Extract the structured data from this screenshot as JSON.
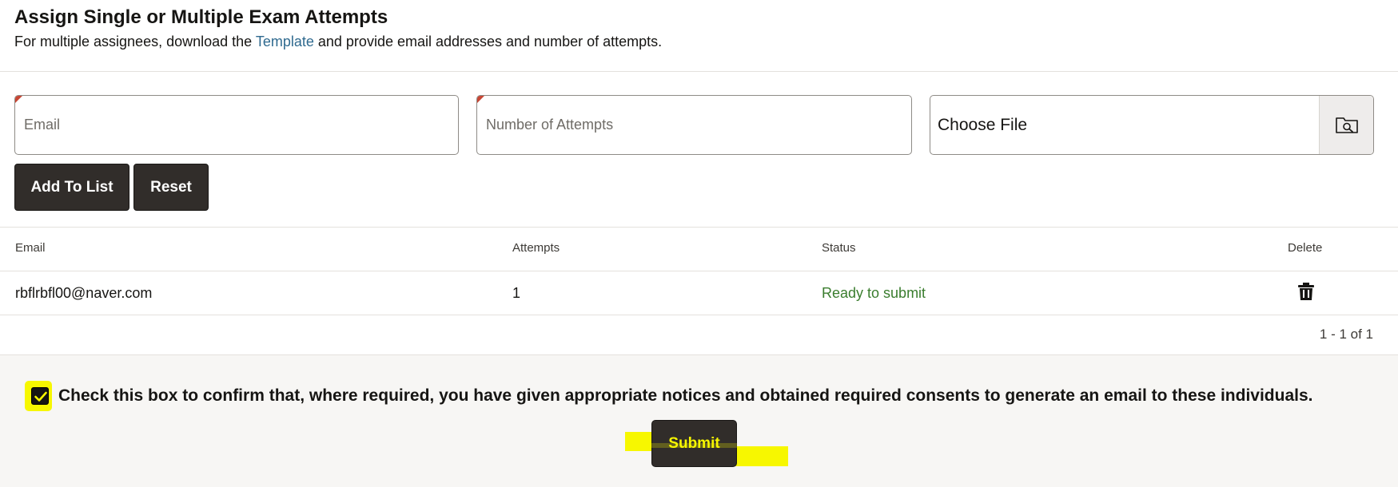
{
  "header": {
    "title": "Assign Single or Multiple Exam Attempts",
    "subtitle_before": "For multiple assignees, download the ",
    "subtitle_link": "Template",
    "subtitle_after": " and provide email addresses and number of attempts."
  },
  "form": {
    "email_placeholder": "Email",
    "attempts_placeholder": "Number of Attempts",
    "file_placeholder": "Choose File",
    "browse_icon": "folder-search-icon",
    "add_label": "Add To List",
    "reset_label": "Reset"
  },
  "table": {
    "columns": [
      "Email",
      "Attempts",
      "Status",
      "Delete"
    ],
    "rows": [
      {
        "email": "rbflrbfl00@naver.com",
        "attempts": "1",
        "status": "Ready to submit",
        "delete_icon": "trash-icon"
      }
    ],
    "pagination": "1 - 1 of 1"
  },
  "footer": {
    "consent_checked": true,
    "consent_text": "Check this box to confirm that, where required, you have given appropriate notices and obtained required consents to generate an email to these individuals.",
    "submit_label": "Submit"
  },
  "colors": {
    "button_bg": "#312d2a",
    "status_ok": "#3a7d2e",
    "link": "#2f6a8f",
    "required_marker": "#c74634",
    "highlight": "#f7f700"
  }
}
